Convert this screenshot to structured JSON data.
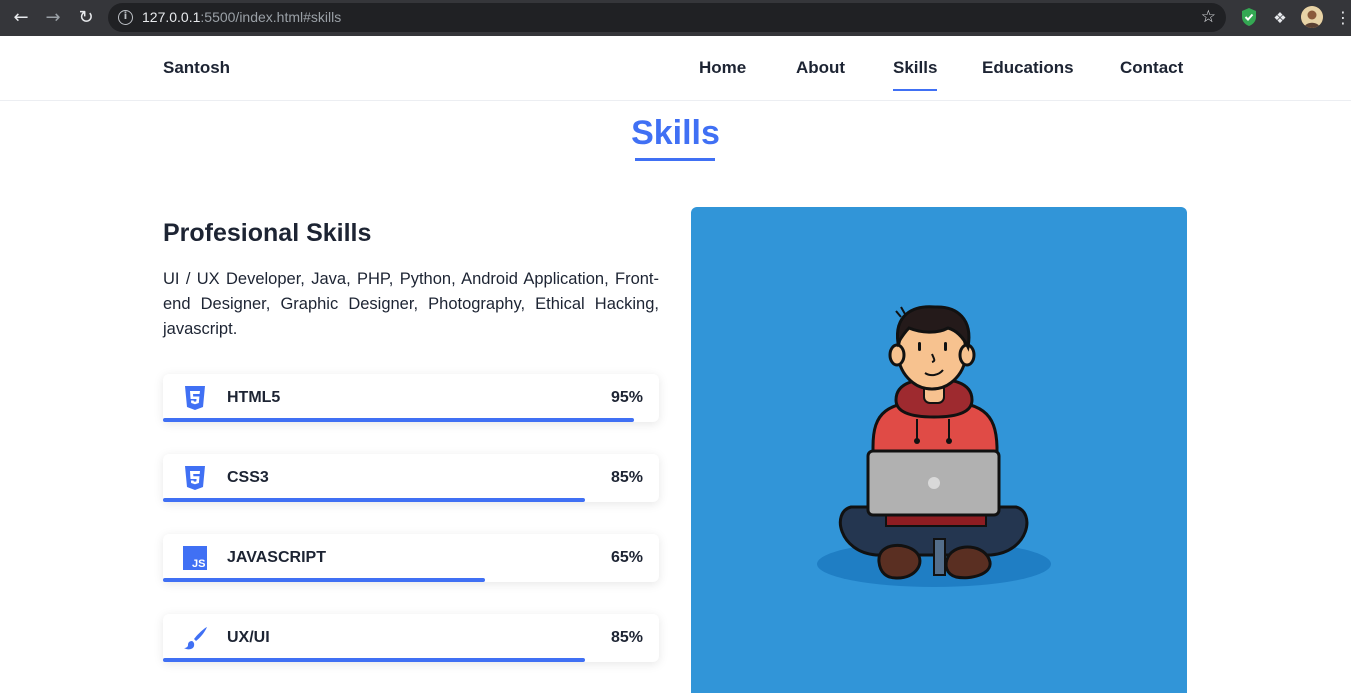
{
  "browser": {
    "url_host": "127.0.0.1",
    "url_rest": ":5500/index.html#skills"
  },
  "header": {
    "brand": "Santosh",
    "nav": [
      "Home",
      "About",
      "Skills",
      "Educations",
      "Contact"
    ],
    "active_nav": "Skills"
  },
  "section": {
    "title": "Skills"
  },
  "skills": {
    "heading": "Profesional Skills",
    "description": "UI / UX Developer, Java, PHP, Python, Android Application, Front-end Designer, Graphic Designer, Photography, Ethical Hacking, javascript.",
    "items": [
      {
        "name": "HTML5",
        "percent_label": "95%",
        "level": 0.95,
        "icon": "html5-icon"
      },
      {
        "name": "CSS3",
        "percent_label": "85%",
        "level": 0.85,
        "icon": "css3-icon"
      },
      {
        "name": "JAVASCRIPT",
        "percent_label": "65%",
        "level": 0.65,
        "icon": "javascript-icon"
      },
      {
        "name": "UX/UI",
        "percent_label": "85%",
        "level": 0.85,
        "icon": "paintbrush-icon"
      }
    ]
  },
  "colors": {
    "accent": "#4070f4",
    "illustration_bg": "#3195d8",
    "text": "#1d2433"
  }
}
